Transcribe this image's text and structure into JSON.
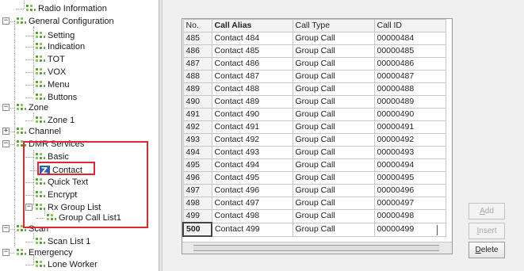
{
  "tree": {
    "items": [
      {
        "label": "Radio Information",
        "icon": "node-icon"
      },
      {
        "label": "General Configuration",
        "icon": "node-icon",
        "expander": "−"
      },
      {
        "label": "Setting",
        "icon": "node-icon"
      },
      {
        "label": "Indication",
        "icon": "node-icon"
      },
      {
        "label": "TOT",
        "icon": "node-icon"
      },
      {
        "label": "VOX",
        "icon": "node-icon"
      },
      {
        "label": "Menu",
        "icon": "node-icon"
      },
      {
        "label": "Buttons",
        "icon": "node-icon"
      },
      {
        "label": "Zone",
        "icon": "node-icon",
        "expander": "−"
      },
      {
        "label": "Zone 1",
        "icon": "node-icon"
      },
      {
        "label": "Channel",
        "icon": "node-icon",
        "expander": "+"
      },
      {
        "label": "DMR Services",
        "icon": "node-icon",
        "expander": "−"
      },
      {
        "label": "Basic",
        "icon": "node-icon"
      },
      {
        "label": "Contact",
        "icon": "contact-z-icon",
        "selected": true
      },
      {
        "label": "Quick Text",
        "icon": "node-icon"
      },
      {
        "label": "Encrypt",
        "icon": "node-icon"
      },
      {
        "label": "Rx Group List",
        "icon": "node-icon",
        "expander": "−"
      },
      {
        "label": "Group Call List1",
        "icon": "node-icon"
      },
      {
        "label": "Scan",
        "icon": "node-icon",
        "expander": "−"
      },
      {
        "label": "Scan List 1",
        "icon": "node-icon"
      },
      {
        "label": "Emergency",
        "icon": "node-icon",
        "expander": "−"
      },
      {
        "label": "Lone Worker",
        "icon": "node-icon"
      }
    ]
  },
  "highlight_color": "#e0262f",
  "table": {
    "headers": [
      "No.",
      "Call Alias",
      "Call Type",
      "Call ID"
    ],
    "rows": [
      [
        "485",
        "Contact 484",
        "Group Call",
        "00000484"
      ],
      [
        "486",
        "Contact 485",
        "Group Call",
        "00000485"
      ],
      [
        "487",
        "Contact 486",
        "Group Call",
        "00000486"
      ],
      [
        "488",
        "Contact 487",
        "Group Call",
        "00000487"
      ],
      [
        "489",
        "Contact 488",
        "Group Call",
        "00000488"
      ],
      [
        "490",
        "Contact 489",
        "Group Call",
        "00000489"
      ],
      [
        "491",
        "Contact 490",
        "Group Call",
        "00000490"
      ],
      [
        "492",
        "Contact 491",
        "Group Call",
        "00000491"
      ],
      [
        "493",
        "Contact 492",
        "Group Call",
        "00000492"
      ],
      [
        "494",
        "Contact 493",
        "Group Call",
        "00000493"
      ],
      [
        "495",
        "Contact 494",
        "Group Call",
        "00000494"
      ],
      [
        "496",
        "Contact 495",
        "Group Call",
        "00000495"
      ],
      [
        "497",
        "Contact 496",
        "Group Call",
        "00000496"
      ],
      [
        "498",
        "Contact 497",
        "Group Call",
        "00000497"
      ],
      [
        "499",
        "Contact 498",
        "Group Call",
        "00000498"
      ],
      [
        "500",
        "Contact 499",
        "Group Call",
        "00000499"
      ]
    ]
  },
  "buttons": {
    "add": {
      "first": "A",
      "rest": "dd"
    },
    "insert": {
      "first": "I",
      "rest": "nsert"
    },
    "delete": {
      "first": "D",
      "rest": "elete"
    }
  }
}
